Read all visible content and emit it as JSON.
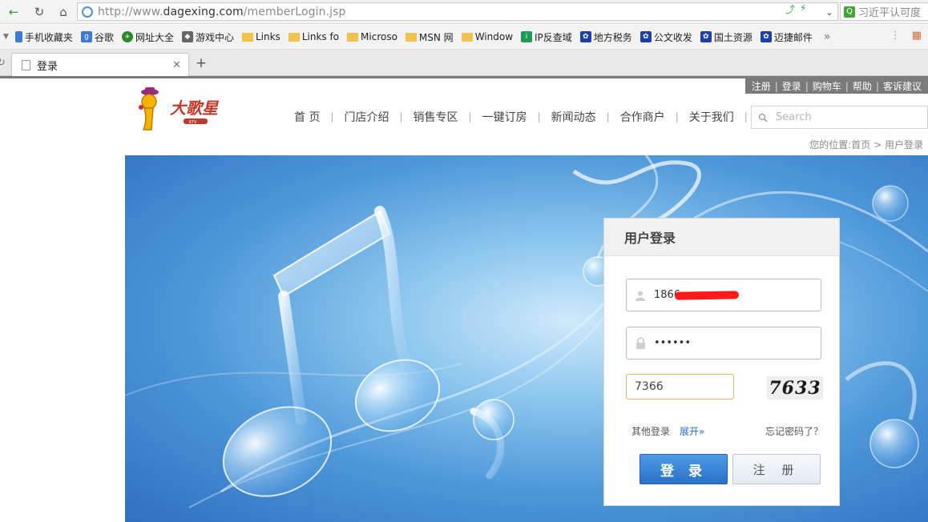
{
  "browser": {
    "url_prefix": "http://www.",
    "url_domain": "dagexing.com",
    "url_path": "/memberLogin.jsp",
    "search_engine_text": "习近平认可度"
  },
  "bookmarks": [
    {
      "label": "手机收藏夹",
      "icon": "phone-icon"
    },
    {
      "label": "谷歌",
      "icon": "google-icon"
    },
    {
      "label": "网址大全",
      "icon": "web-directory-icon"
    },
    {
      "label": "游戏中心",
      "icon": "gamepad-icon"
    },
    {
      "label": "Links",
      "icon": "folder-icon"
    },
    {
      "label": "Links fo",
      "icon": "folder-icon"
    },
    {
      "label": "Microso",
      "icon": "folder-icon"
    },
    {
      "label": "MSN 网",
      "icon": "folder-icon"
    },
    {
      "label": "Window",
      "icon": "folder-icon"
    },
    {
      "label": "IP反查域",
      "icon": "ip-lookup-icon"
    },
    {
      "label": "地方税务",
      "icon": "paw-icon"
    },
    {
      "label": "公文收发",
      "icon": "paw-icon"
    },
    {
      "label": "国土资源",
      "icon": "paw-icon"
    },
    {
      "label": "迈捷邮件",
      "icon": "paw-icon"
    }
  ],
  "tab": {
    "title": "登录"
  },
  "site": {
    "top_links": [
      "注册",
      "登录",
      "购物车",
      "帮助",
      "客诉建议"
    ],
    "nav": [
      "首 页",
      "门店介绍",
      "销售专区",
      "一键订房",
      "新闻动态",
      "合作商户",
      "关于我们"
    ],
    "search_placeholder": "Search",
    "breadcrumb": "您的位置:首页 > 用户登录",
    "logo_text": "大歌星",
    "logo_sub": "KTV"
  },
  "login": {
    "title": "用户登录",
    "username_value": "1866",
    "password_value": "••••••",
    "captcha_value": "7366",
    "captcha_image_text": "7633",
    "other_login": "其他登录",
    "expand": "展开»",
    "forgot": "忘记密码了？",
    "login_button": "登 录",
    "register_button": "注 册"
  },
  "colors": {
    "accent": "#2a71c8",
    "top_links_bg": "#7a7a7a",
    "redaction": "#ff1a1a"
  }
}
